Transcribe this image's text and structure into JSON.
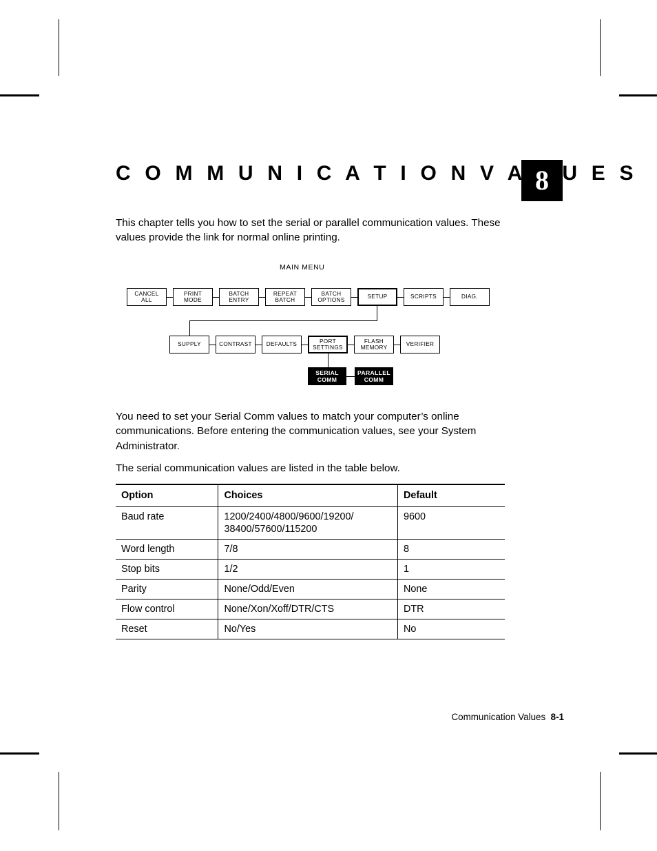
{
  "chapter": {
    "title": "C O M M U N I C A T I O N   V A L U E S",
    "number": "8"
  },
  "paragraphs": {
    "intro": "This chapter tells you how to set the serial or parallel communication values.  These values provide the link for normal online printing.",
    "need": "You need to set your Serial Comm values to match your computer’s online communications.  Before entering the communication values, see your System Administrator.",
    "table_intro": "The serial communication values are listed in the table below."
  },
  "menu_map": {
    "heading": "MAIN MENU",
    "row1": [
      {
        "label": "CANCEL\nALL",
        "style": "plain"
      },
      {
        "label": "PRINT\nMODE",
        "style": "plain"
      },
      {
        "label": "BATCH\nENTRY",
        "style": "plain"
      },
      {
        "label": "REPEAT\nBATCH",
        "style": "plain"
      },
      {
        "label": "BATCH\nOPTIONS",
        "style": "plain"
      },
      {
        "label": "SETUP",
        "style": "thick"
      },
      {
        "label": "SCRIPTS",
        "style": "plain"
      },
      {
        "label": "DIAG.",
        "style": "plain"
      }
    ],
    "row2": [
      {
        "label": "SUPPLY",
        "style": "plain"
      },
      {
        "label": "CONTRAST",
        "style": "plain"
      },
      {
        "label": "DEFAULTS",
        "style": "plain"
      },
      {
        "label": "PORT\nSETTINGS",
        "style": "thick"
      },
      {
        "label": "FLASH\nMEMORY",
        "style": "plain"
      },
      {
        "label": "VERIFIER",
        "style": "plain"
      }
    ],
    "row3": [
      {
        "label": "SERIAL\nCOMM",
        "style": "filled"
      },
      {
        "label": "PARALLEL\nCOMM",
        "style": "filled"
      }
    ]
  },
  "table": {
    "headers": [
      "Option",
      "Choices",
      "Default"
    ],
    "rows": [
      {
        "option": "Baud rate",
        "choices": "1200/2400/4800/9600/19200/\n38400/57600/115200",
        "default": "9600"
      },
      {
        "option": "Word length",
        "choices": "7/8",
        "default": "8"
      },
      {
        "option": "Stop bits",
        "choices": "1/2",
        "default": "1"
      },
      {
        "option": "Parity",
        "choices": "None/Odd/Even",
        "default": "None"
      },
      {
        "option": "Flow control",
        "choices": "None/Xon/Xoff/DTR/CTS",
        "default": "DTR"
      },
      {
        "option": "Reset",
        "choices": "No/Yes",
        "default": "No"
      }
    ]
  },
  "footer": {
    "text": "Communication Values",
    "page": "8-1"
  }
}
